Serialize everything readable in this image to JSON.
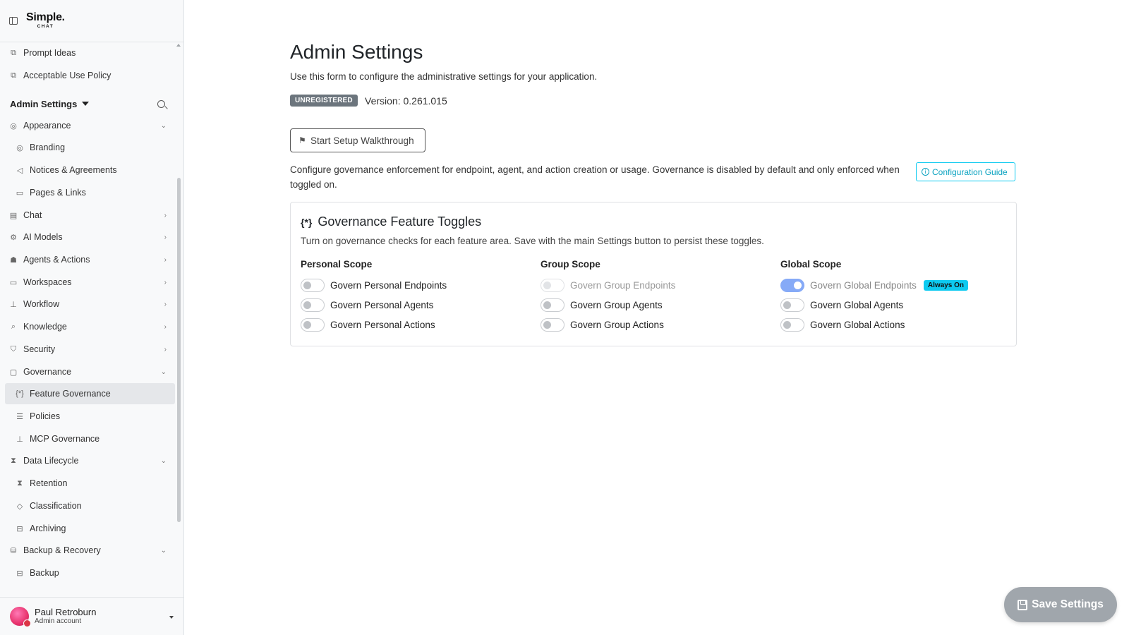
{
  "app": {
    "logo_main": "Simple.",
    "logo_sub": "CHAT"
  },
  "sidebar": {
    "links": [
      {
        "label": "Prompt Ideas",
        "icon": "external-link-icon"
      },
      {
        "label": "Acceptable Use Policy",
        "icon": "external-link-icon"
      }
    ],
    "section_title": "Admin Settings",
    "nav": [
      {
        "label": "Appearance",
        "icon": "palette-icon",
        "chevron": "down"
      },
      {
        "label": "Branding",
        "icon": "palette-icon",
        "child": true
      },
      {
        "label": "Notices & Agreements",
        "icon": "megaphone-icon",
        "child": true
      },
      {
        "label": "Pages & Links",
        "icon": "folder-icon",
        "child": true
      },
      {
        "label": "Chat",
        "icon": "chat-icon",
        "chevron": "right"
      },
      {
        "label": "AI Models",
        "icon": "cpu-icon",
        "chevron": "right"
      },
      {
        "label": "Agents & Actions",
        "icon": "robot-icon",
        "chevron": "right"
      },
      {
        "label": "Workspaces",
        "icon": "folder-icon",
        "chevron": "right"
      },
      {
        "label": "Workflow",
        "icon": "diagram-icon",
        "chevron": "right"
      },
      {
        "label": "Knowledge",
        "icon": "search-icon",
        "chevron": "right"
      },
      {
        "label": "Security",
        "icon": "shield-icon",
        "chevron": "right"
      },
      {
        "label": "Governance",
        "icon": "clipboard-check-icon",
        "chevron": "down"
      },
      {
        "label": "Feature Governance",
        "icon": "braces-asterisk-icon",
        "child": true,
        "active": true
      },
      {
        "label": "Policies",
        "icon": "sliders-icon",
        "child": true
      },
      {
        "label": "MCP Governance",
        "icon": "diagram-icon",
        "child": true
      },
      {
        "label": "Data Lifecycle",
        "icon": "hourglass-icon",
        "chevron": "down"
      },
      {
        "label": "Retention",
        "icon": "hourglass-icon",
        "child": true
      },
      {
        "label": "Classification",
        "icon": "tag-icon",
        "child": true
      },
      {
        "label": "Archiving",
        "icon": "archive-icon",
        "child": true
      },
      {
        "label": "Backup & Recovery",
        "icon": "database-icon",
        "chevron": "down"
      },
      {
        "label": "Backup",
        "icon": "archive-icon",
        "child": true
      }
    ],
    "user": {
      "name": "Paul Retroburn",
      "role": "Admin account"
    }
  },
  "main": {
    "title": "Admin Settings",
    "subtitle": "Use this form to configure the administrative settings for your application.",
    "badge": "UNREGISTERED",
    "version": "Version: 0.261.015",
    "walkthrough_label": "Start Setup Walkthrough",
    "governance_desc": "Configure governance enforcement for endpoint, agent, and action creation or usage. Governance is disabled by default and only enforced when toggled on.",
    "config_guide_label": "Configuration Guide",
    "card": {
      "title": "Governance Feature Toggles",
      "subtitle": "Turn on governance checks for each feature area. Save with the main Settings button to persist these toggles.",
      "scopes": [
        {
          "title": "Personal Scope",
          "toggles": [
            {
              "label": "Govern Personal Endpoints",
              "on": false,
              "disabled": false
            },
            {
              "label": "Govern Personal Agents",
              "on": false,
              "disabled": false
            },
            {
              "label": "Govern Personal Actions",
              "on": false,
              "disabled": false
            }
          ]
        },
        {
          "title": "Group Scope",
          "toggles": [
            {
              "label": "Govern Group Endpoints",
              "on": false,
              "disabled": true
            },
            {
              "label": "Govern Group Agents",
              "on": false,
              "disabled": false
            },
            {
              "label": "Govern Group Actions",
              "on": false,
              "disabled": false
            }
          ]
        },
        {
          "title": "Global Scope",
          "toggles": [
            {
              "label": "Govern Global Endpoints",
              "on": true,
              "disabled": false,
              "badge": "Always On",
              "muted": true
            },
            {
              "label": "Govern Global Agents",
              "on": false,
              "disabled": false
            },
            {
              "label": "Govern Global Actions",
              "on": false,
              "disabled": false
            }
          ]
        }
      ]
    },
    "save_label": "Save Settings"
  },
  "colors": {
    "accent": "#0dcaf0",
    "switch_on": "#86aaf7",
    "badge_grey": "#6c757d",
    "save_bg": "#a0a6ac"
  }
}
